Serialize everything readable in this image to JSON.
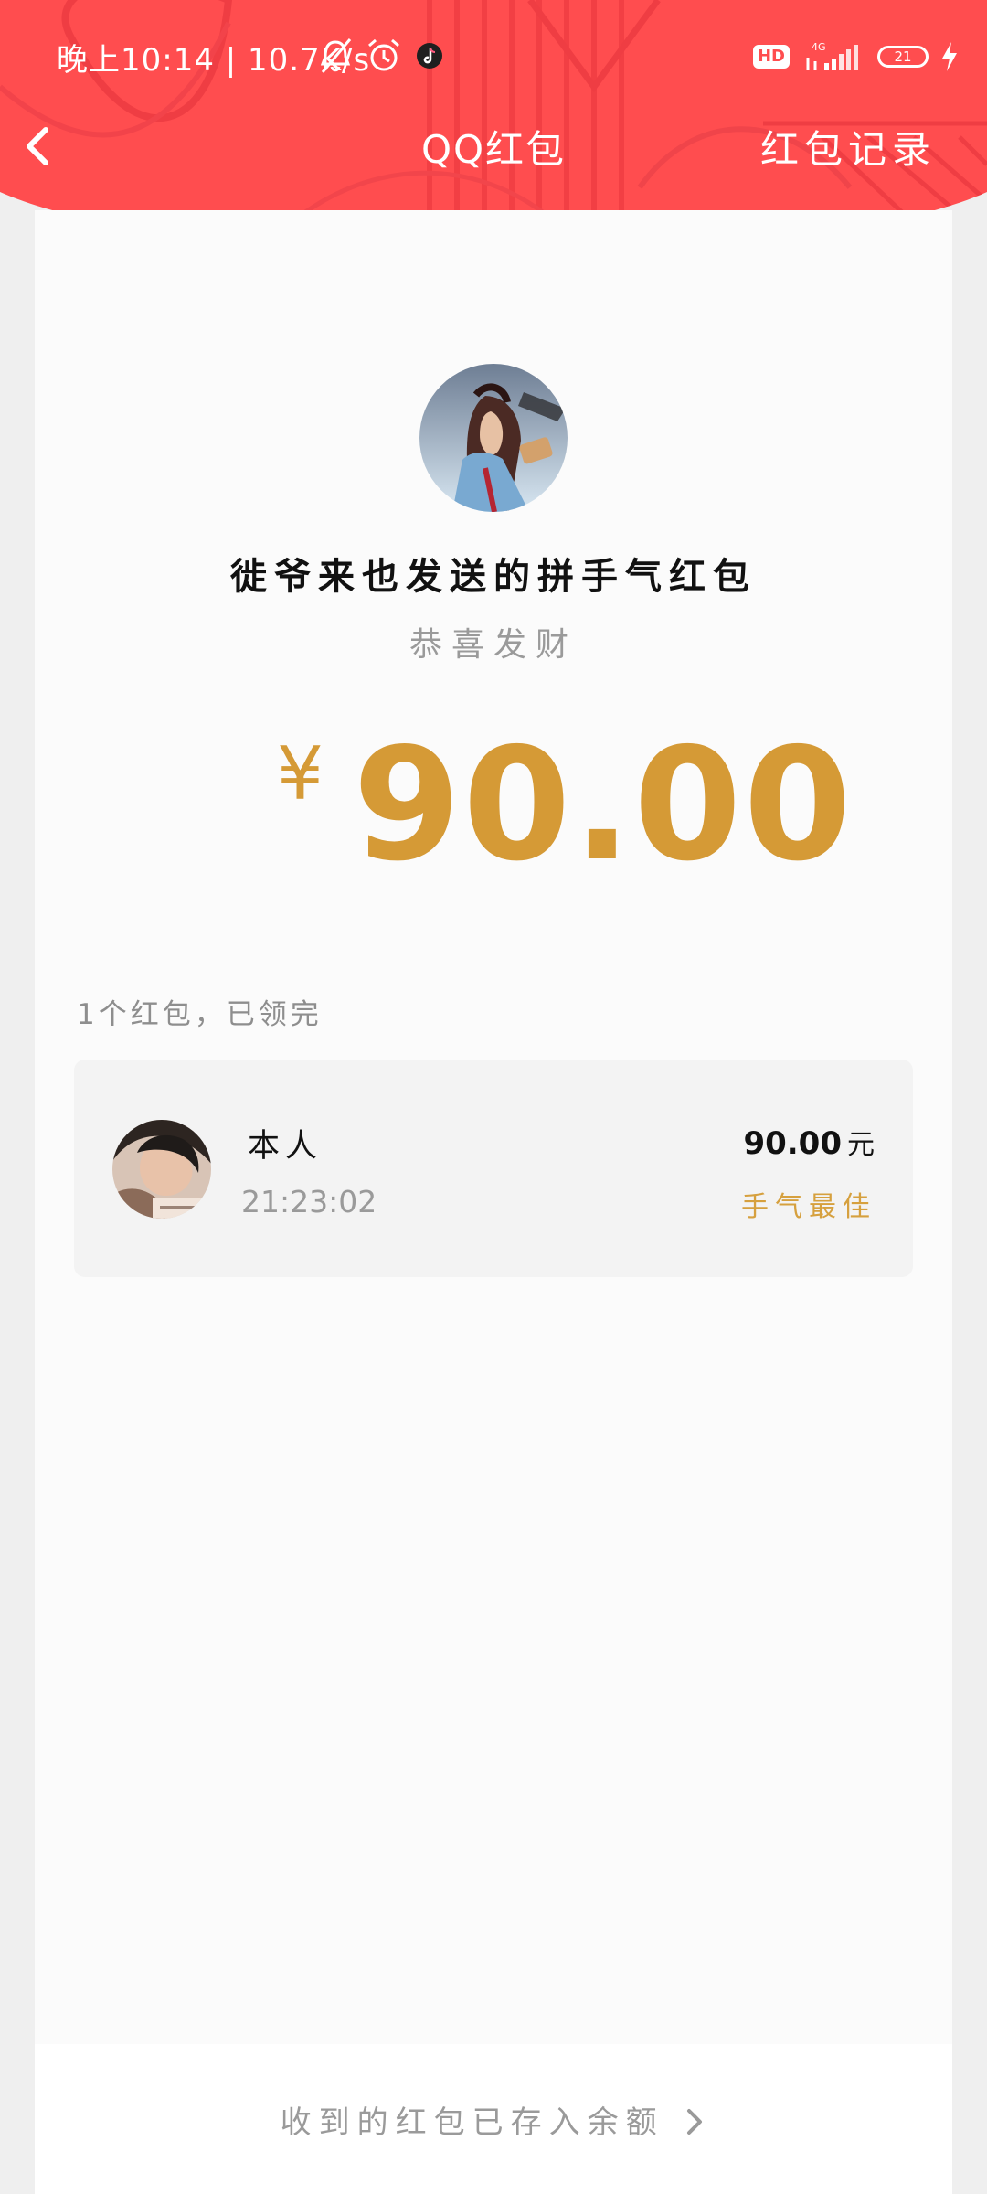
{
  "status_bar": {
    "time_and_speed": "晚上10:14 | 10.7K/s",
    "hd_label": "HD",
    "network_label": "4G",
    "battery_level": "21"
  },
  "nav": {
    "title": "QQ红包",
    "record_link": "红包记录"
  },
  "sender": {
    "title": "徙爷来也发送的拼手气红包",
    "greeting": "恭喜发财"
  },
  "amount": {
    "currency_symbol": "¥",
    "value": "90.00"
  },
  "summary": {
    "claim_status": "1个红包，已领完"
  },
  "recipients": [
    {
      "name": "本人",
      "time": "21:23:02",
      "amount": "90.00",
      "unit": "元",
      "badge": "手气最佳"
    }
  ],
  "footer": {
    "balance_link": "收到的红包已存入余额"
  },
  "colors": {
    "header_red": "#ff4d4f",
    "accent_gold": "#d59a36",
    "text_gray": "#9a9a9a",
    "card_bg": "#f3f3f3"
  }
}
